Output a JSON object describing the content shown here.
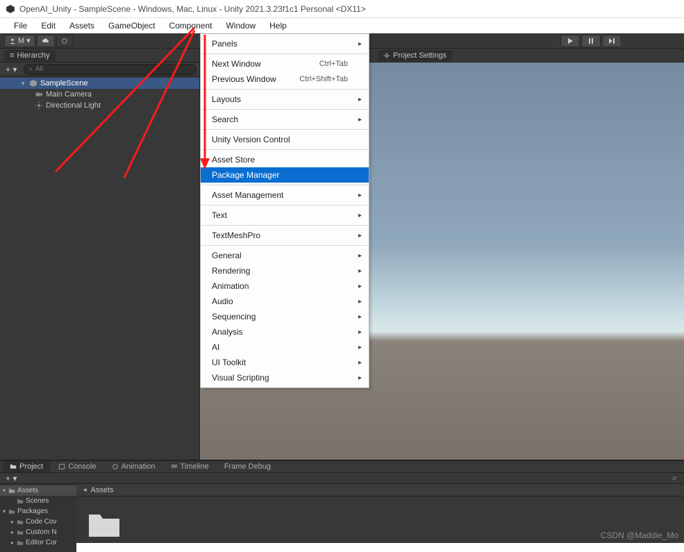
{
  "title": "OpenAI_Unity - SampleScene - Windows, Mac, Linux - Unity 2021.3.23f1c1 Personal <DX11>",
  "menubar": [
    "File",
    "Edit",
    "Assets",
    "GameObject",
    "Component",
    "Window",
    "Help"
  ],
  "toolbarAccount": "M",
  "hierarchy": {
    "title": "Hierarchy",
    "searchPlaceholder": "All",
    "scene": "SampleScene",
    "children": [
      "Main Camera",
      "Directional Light"
    ]
  },
  "sceneTab": "Project Settings",
  "dropdown": [
    {
      "label": "Panels",
      "sub": true
    },
    {
      "sep": true
    },
    {
      "label": "Next Window",
      "shortcut": "Ctrl+Tab"
    },
    {
      "label": "Previous Window",
      "shortcut": "Ctrl+Shift+Tab"
    },
    {
      "sep": true
    },
    {
      "label": "Layouts",
      "sub": true
    },
    {
      "sep": true
    },
    {
      "label": "Search",
      "sub": true
    },
    {
      "sep": true
    },
    {
      "label": "Unity Version Control"
    },
    {
      "sep": true
    },
    {
      "label": "Asset Store"
    },
    {
      "label": "Package Manager",
      "sel": true
    },
    {
      "sep": true
    },
    {
      "label": "Asset Management",
      "sub": true
    },
    {
      "sep": true
    },
    {
      "label": "Text",
      "sub": true
    },
    {
      "sep": true
    },
    {
      "label": "TextMeshPro",
      "sub": true
    },
    {
      "sep": true
    },
    {
      "label": "General",
      "sub": true
    },
    {
      "label": "Rendering",
      "sub": true
    },
    {
      "label": "Animation",
      "sub": true
    },
    {
      "label": "Audio",
      "sub": true
    },
    {
      "label": "Sequencing",
      "sub": true
    },
    {
      "label": "Analysis",
      "sub": true
    },
    {
      "label": "AI",
      "sub": true
    },
    {
      "label": "UI Toolkit",
      "sub": true
    },
    {
      "label": "Visual Scripting",
      "sub": true
    }
  ],
  "project": {
    "tabs": [
      "Project",
      "Console",
      "Animation",
      "Timeline",
      "Frame Debug"
    ],
    "breadcrumb": "Assets",
    "tree": [
      {
        "label": "Assets",
        "depth": 0,
        "open": true,
        "sel": true
      },
      {
        "label": "Scenes",
        "depth": 1
      },
      {
        "label": "Packages",
        "depth": 0,
        "open": true
      },
      {
        "label": "Code Cov",
        "depth": 1
      },
      {
        "label": "Custom N",
        "depth": 1
      },
      {
        "label": "Editor Cor",
        "depth": 1
      }
    ]
  },
  "watermark": "CSDN @Maddie_Mo"
}
